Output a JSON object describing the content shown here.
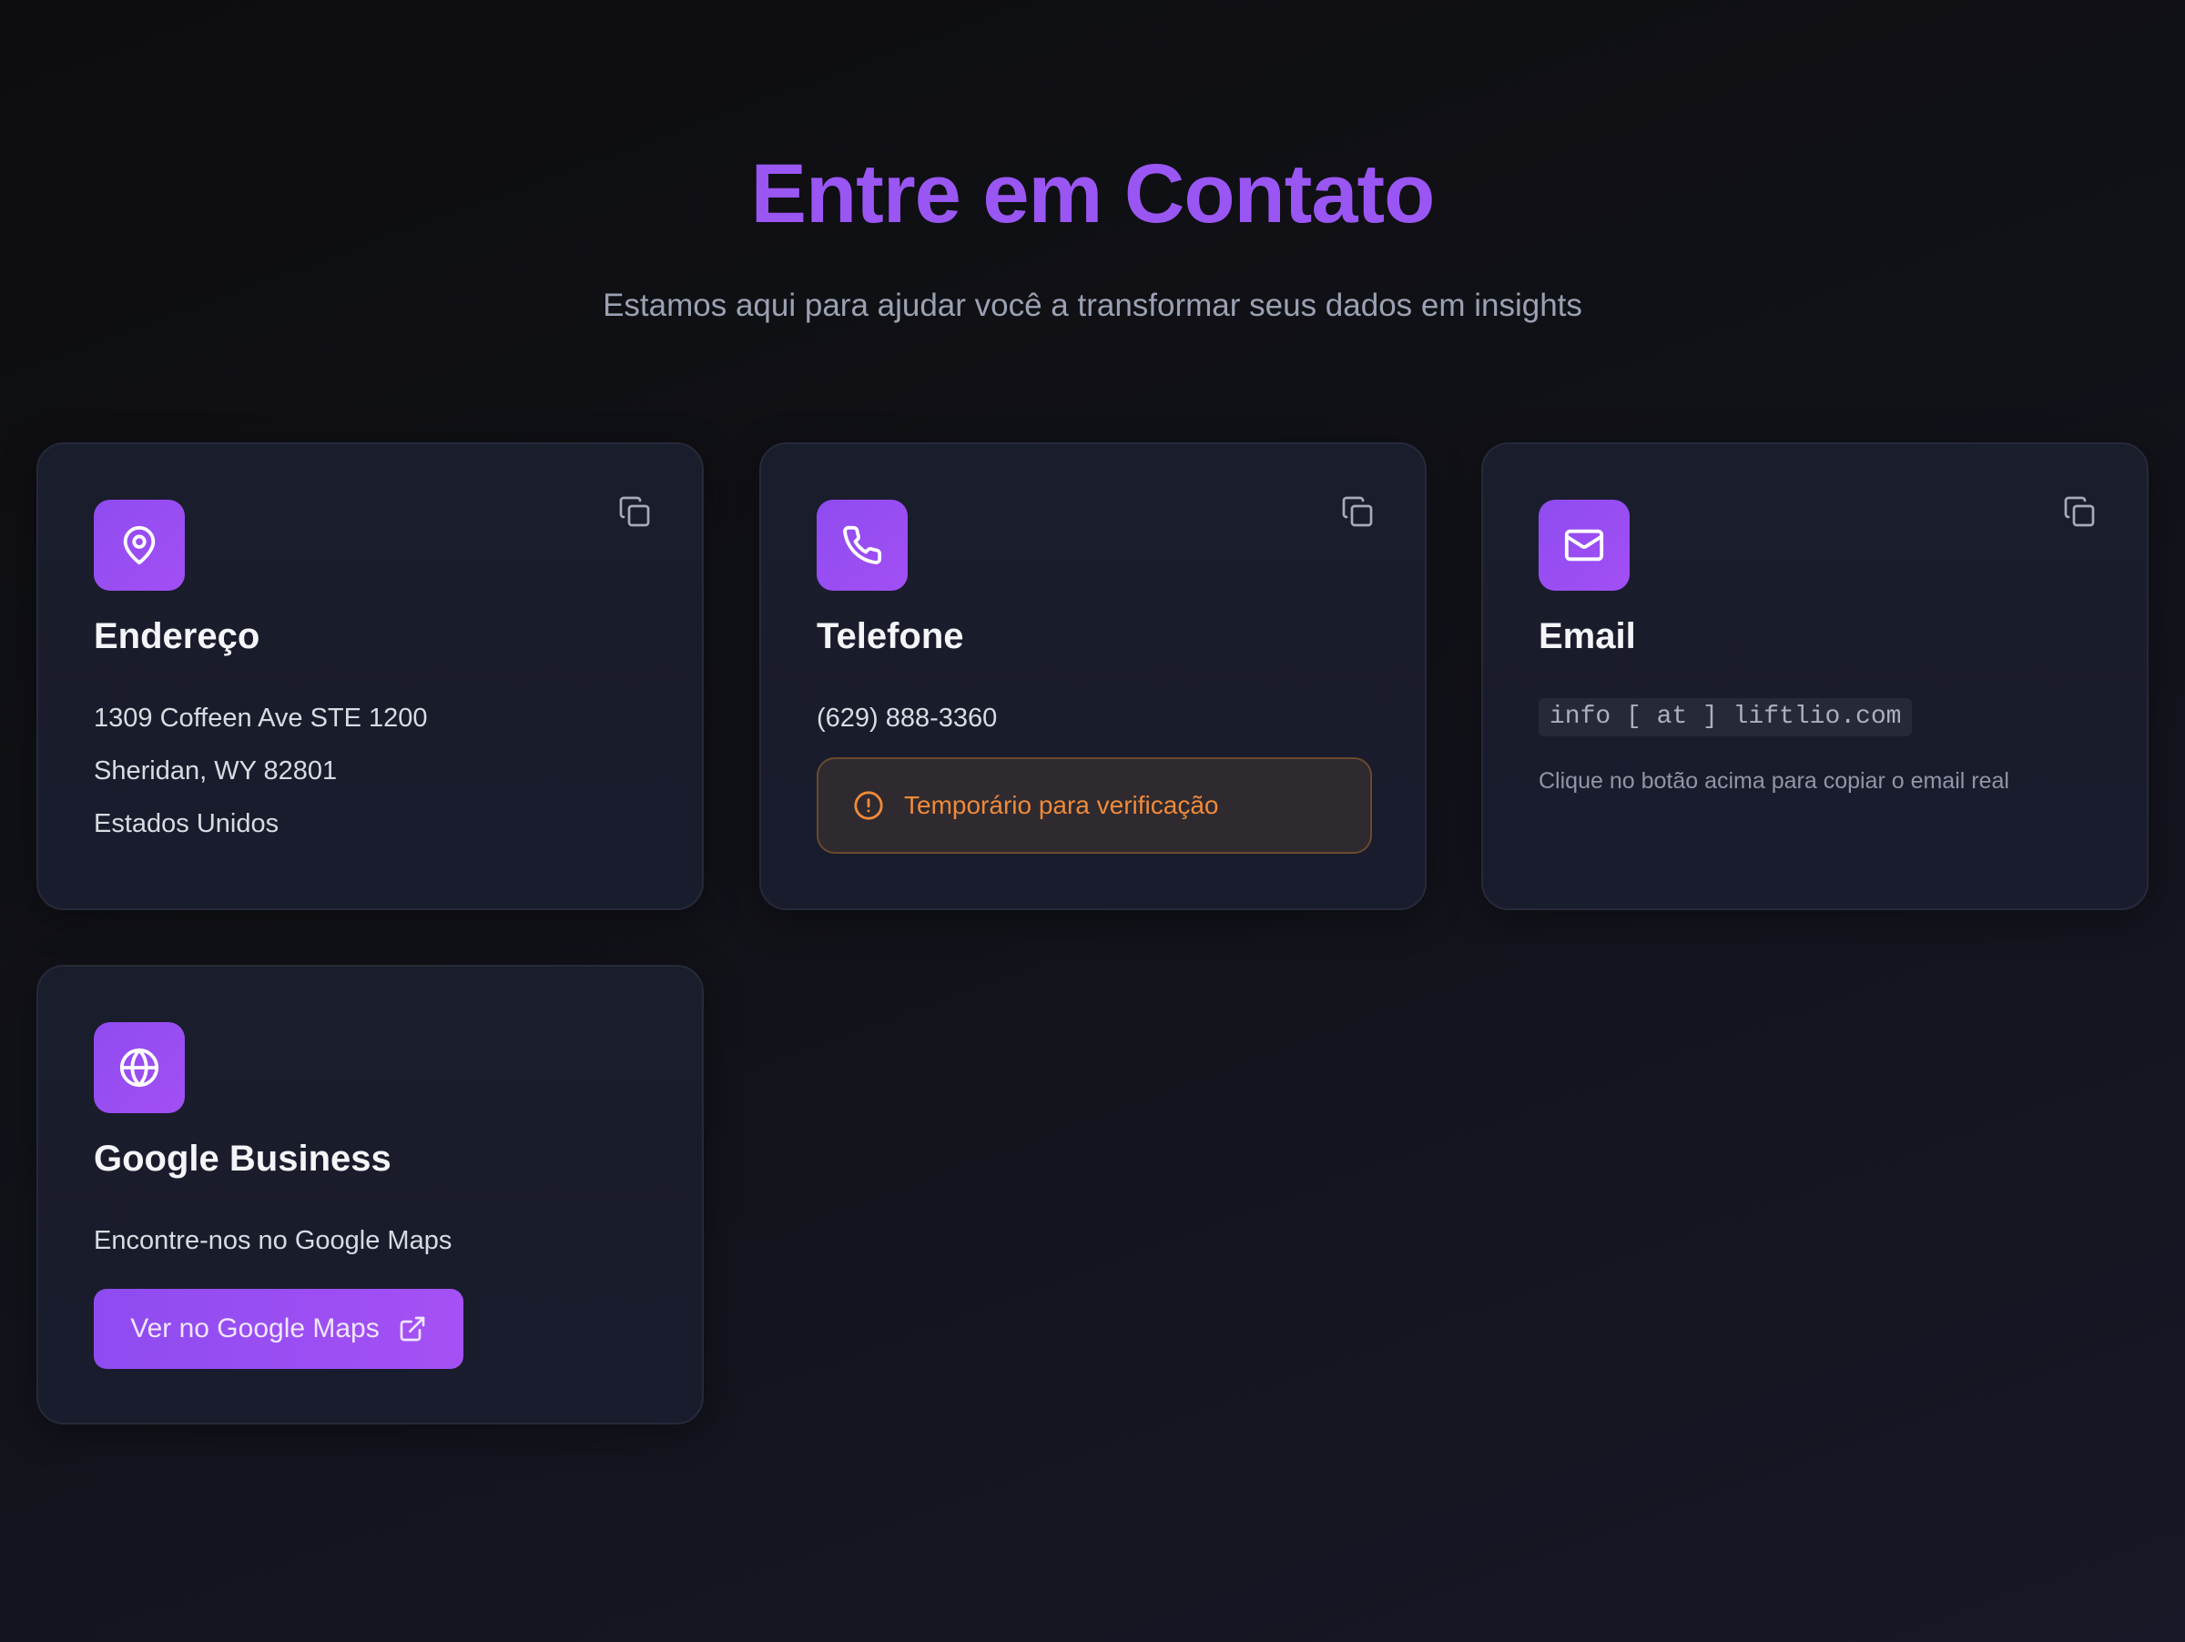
{
  "header": {
    "title": "Entre em Contato",
    "subtitle": "Estamos aqui para ajudar você a transformar seus dados em insights"
  },
  "cards": {
    "address": {
      "icon": "map-pin-icon",
      "title": "Endereço",
      "lines": [
        "1309 Coffeen Ave STE 1200",
        "Sheridan, WY 82801",
        "Estados Unidos"
      ],
      "copy_icon": "copy-icon"
    },
    "phone": {
      "icon": "phone-icon",
      "title": "Telefone",
      "number": "(629) 888-3360",
      "warning_icon": "alert-circle-icon",
      "warning": "Temporário para verificação",
      "copy_icon": "copy-icon"
    },
    "email": {
      "icon": "mail-icon",
      "title": "Email",
      "address": "info [ at ] liftlio.com",
      "hint": "Clique no botão acima para copiar o email real",
      "copy_icon": "copy-icon"
    },
    "google": {
      "icon": "globe-icon",
      "title": "Google Business",
      "description": "Encontre-nos no Google Maps",
      "button_label": "Ver no Google Maps",
      "button_icon": "external-link-icon"
    }
  },
  "colors": {
    "accent": "#9a56f3",
    "warning": "#f08a3a",
    "card_bg": "#1a1d2b"
  }
}
